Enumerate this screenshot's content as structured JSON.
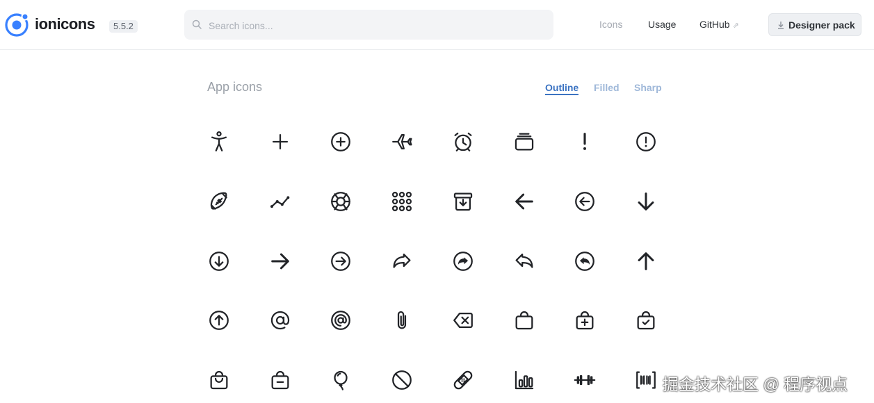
{
  "header": {
    "brand": "ionicons",
    "version": "5.5.2",
    "search_placeholder": "Search icons...",
    "nav": {
      "icons": "Icons",
      "usage": "Usage",
      "github": "GitHub"
    },
    "designer_pack": "Designer pack"
  },
  "section": {
    "title": "App icons",
    "tabs": [
      "Outline",
      "Filled",
      "Sharp"
    ],
    "active_tab": "Outline"
  },
  "icons": [
    "accessibility-outline",
    "add-outline",
    "add-circle-outline",
    "airplane-outline",
    "alarm-outline",
    "albums-outline",
    "alert-outline",
    "alert-circle-outline",
    "american-football-outline",
    "analytics-outline",
    "aperture-outline",
    "apps-outline",
    "archive-outline",
    "arrow-back-outline",
    "arrow-back-circle-outline",
    "arrow-down-outline",
    "arrow-down-circle-outline",
    "arrow-forward-outline",
    "arrow-forward-circle-outline",
    "arrow-redo-outline",
    "arrow-redo-circle-outline",
    "arrow-undo-outline",
    "arrow-undo-circle-outline",
    "arrow-up-outline",
    "arrow-up-circle-outline",
    "at-outline",
    "at-circle-outline",
    "attach-outline",
    "backspace-outline",
    "bag-outline",
    "bag-add-outline",
    "bag-check-outline",
    "bag-handle-outline",
    "bag-remove-outline",
    "balloon-outline",
    "ban-outline",
    "bandage-outline",
    "bar-chart-outline",
    "barbell-outline",
    "barcode-outline"
  ],
  "watermark": "掘金技术社区 @ 程序视点",
  "colors": {
    "accent": "#3b73c2",
    "tab_inactive": "#9fb8d9",
    "icon": "#222428"
  }
}
